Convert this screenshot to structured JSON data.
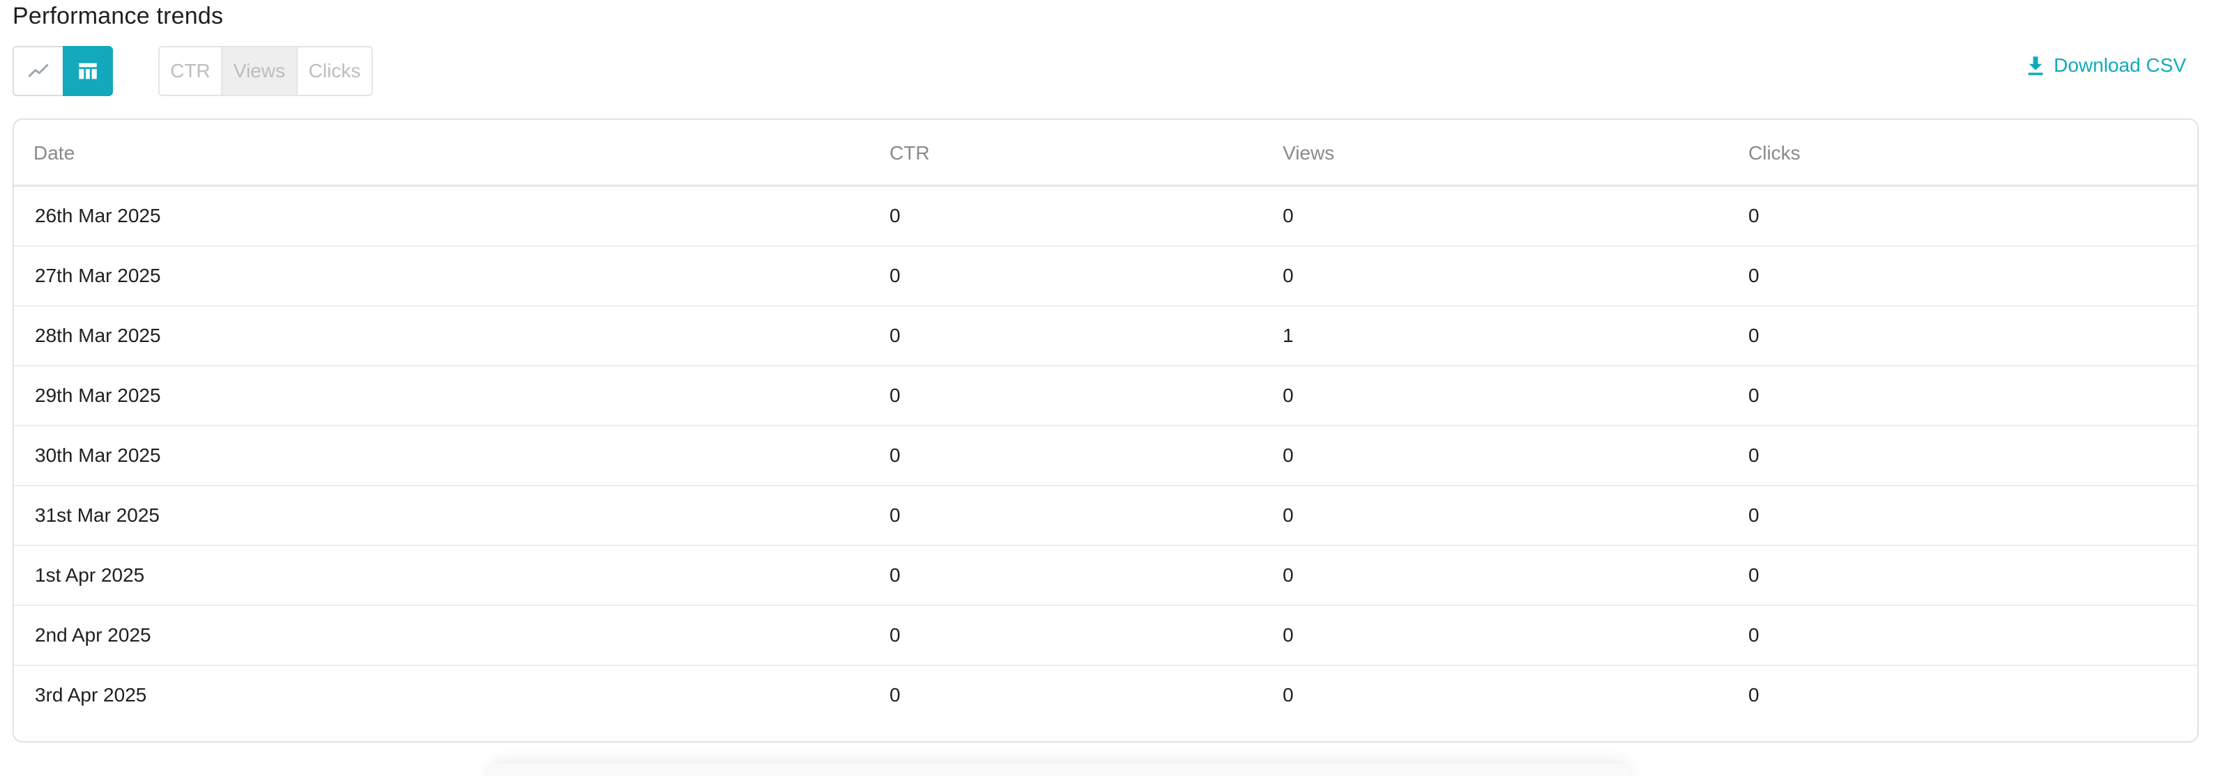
{
  "title": "Performance trends",
  "view_toggle": {
    "chart_icon": "line-chart-icon",
    "table_icon": "table-icon",
    "active": "table"
  },
  "metrics": {
    "ctr": "CTR",
    "views": "Views",
    "clicks": "Clicks",
    "selected": "Views"
  },
  "download": {
    "label": "Download CSV",
    "icon": "download-icon"
  },
  "colors": {
    "accent": "#12a9bc",
    "border": "#e2e2e2",
    "header_text": "#8a8a8a"
  },
  "table": {
    "headers": [
      "Date",
      "CTR",
      "Views",
      "Clicks"
    ],
    "rows": [
      [
        "26th Mar 2025",
        "0",
        "0",
        "0"
      ],
      [
        "27th Mar 2025",
        "0",
        "0",
        "0"
      ],
      [
        "28th Mar 2025",
        "0",
        "1",
        "0"
      ],
      [
        "29th Mar 2025",
        "0",
        "0",
        "0"
      ],
      [
        "30th Mar 2025",
        "0",
        "0",
        "0"
      ],
      [
        "31st Mar 2025",
        "0",
        "0",
        "0"
      ],
      [
        "1st Apr 2025",
        "0",
        "0",
        "0"
      ],
      [
        "2nd Apr 2025",
        "0",
        "0",
        "0"
      ],
      [
        "3rd Apr 2025",
        "0",
        "0",
        "0"
      ]
    ]
  }
}
